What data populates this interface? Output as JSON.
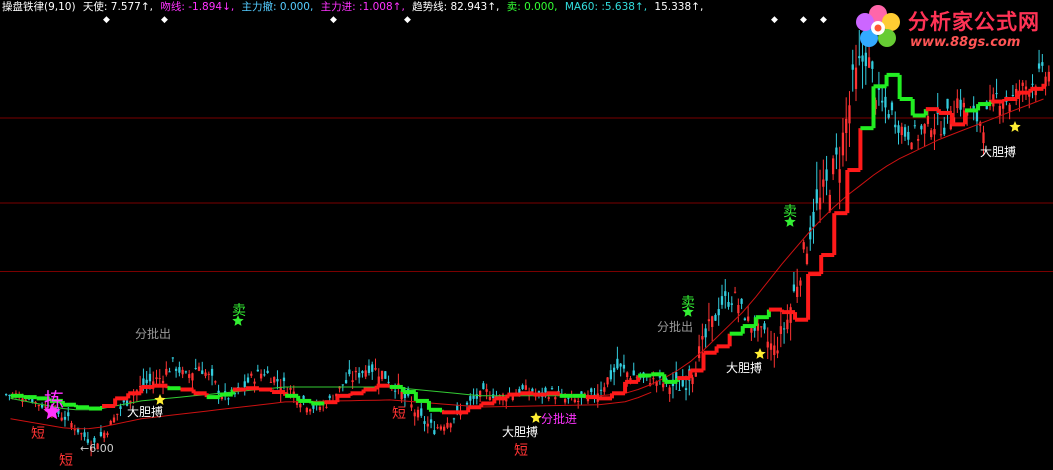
{
  "header": {
    "title": "操盘铁律(9,10)",
    "items": [
      {
        "label": "天使: 7.577↑,",
        "color": "#ffffff"
      },
      {
        "label": "吻线: -1.894↓,",
        "color": "#ff33ff"
      },
      {
        "label": "主力撤: 0.000,",
        "color": "#55ccff"
      },
      {
        "label": "主力进: :1.008↑,",
        "color": "#ff33ff"
      },
      {
        "label": "趋势线: 82.943↑,",
        "color": "#ffffff"
      },
      {
        "label": "卖: 0.000,",
        "color": "#33ff33"
      },
      {
        "label": "MA60: :5.638↑,",
        "color": "#33dddd"
      },
      {
        "label": "15.338↑,",
        "color": "#ffffff"
      }
    ]
  },
  "logo": {
    "text": "分析家公式网",
    "url": "www.88gs.com"
  },
  "colors": {
    "up_candle": "#ff3333",
    "down_candle": "#33ccdd",
    "signal_up": "#ff1a1a",
    "signal_down": "#22ee22",
    "ma_green": "#33cc33",
    "ma_red": "#cc1111",
    "hline": "#7a0000"
  },
  "annotations": [
    {
      "id": "jian",
      "text": "拣",
      "color": "#ff33ff"
    },
    {
      "id": "duan1",
      "text": "短",
      "color": "#ff3333"
    },
    {
      "id": "duan2",
      "text": "短",
      "color": "#ff3333"
    },
    {
      "id": "duan3",
      "text": "短",
      "color": "#ff3333"
    },
    {
      "id": "duan4",
      "text": "短",
      "color": "#ff3333"
    },
    {
      "id": "low",
      "text": "←6.00",
      "color": "#cccccc"
    },
    {
      "id": "fpc1",
      "text": "分批出",
      "color": "#999999"
    },
    {
      "id": "fpc2",
      "text": "分批出",
      "color": "#999999"
    },
    {
      "id": "mai1",
      "text": "卖",
      "color": "#33ee33"
    },
    {
      "id": "mai2",
      "text": "卖",
      "color": "#33ee33"
    },
    {
      "id": "mai3",
      "text": "卖",
      "color": "#33ee33"
    },
    {
      "id": "dd1",
      "text": "大胆搏",
      "color": "#ffffff"
    },
    {
      "id": "dd2",
      "text": "大胆搏",
      "color": "#ffffff"
    },
    {
      "id": "dd3",
      "text": "大胆搏",
      "color": "#ffffff"
    },
    {
      "id": "dd4",
      "text": "大胆搏",
      "color": "#ffffff"
    },
    {
      "id": "fpj",
      "text": "分批进",
      "color": "#ff33ff"
    }
  ],
  "chart_data": {
    "type": "candlestick",
    "series": [
      {
        "name": "趋势线",
        "values": [
          10.4,
          10.3,
          10.2,
          10.0,
          9.7,
          9.5,
          9.4,
          9.6,
          10.2,
          10.6,
          11.1,
          11.2,
          11.0,
          10.9,
          10.6,
          10.3,
          10.5,
          10.9,
          11.0,
          10.9,
          10.7,
          10.4,
          10.0,
          9.8,
          9.9,
          10.4,
          10.6,
          10.9,
          11.2,
          11.1,
          10.7,
          10.0,
          9.3,
          9.1,
          9.1,
          9.5,
          9.8,
          10.2,
          10.5,
          10.6,
          10.5,
          10.6,
          10.4,
          10.4,
          10.3,
          10.2,
          10.6,
          11.5,
          12.0,
          12.1,
          11.5,
          11.8,
          12.4,
          13.8,
          14.3,
          15.3,
          15.9,
          16.6,
          17.2,
          17.0,
          16.4,
          20.0,
          21.5,
          24.8,
          28.2,
          31.5,
          34.8,
          35.7,
          33.8,
          32.5,
          33.0,
          32.7,
          31.8,
          32.9,
          33.4,
          33.6,
          33.8,
          34.3,
          34.6,
          35.0
        ]
      },
      {
        "name": "MA60",
        "values": [
          10.2,
          10.0,
          9.8,
          9.6,
          9.4,
          9.3,
          9.3,
          9.4,
          9.6,
          9.8,
          10.0,
          10.1,
          10.2,
          10.3,
          10.4,
          10.5,
          10.6,
          10.7,
          10.8,
          10.9,
          11.0,
          11.1,
          11.1,
          11.1,
          11.1,
          11.1,
          11.1,
          11.1,
          11.1,
          11.1,
          11.0,
          10.9,
          10.8,
          10.7,
          10.6,
          10.5,
          10.4,
          10.4,
          10.4,
          10.4,
          10.4,
          10.4,
          10.4,
          10.4,
          10.4,
          10.4,
          10.5,
          10.6,
          10.9,
          11.3,
          11.8,
          12.4,
          13.1,
          14.0,
          15.0,
          16.0,
          17.0,
          18.2,
          19.5,
          20.8,
          22.0,
          23.2,
          24.3,
          25.3,
          26.2,
          27.0,
          27.8,
          28.5,
          29.1,
          29.6,
          30.1,
          30.6,
          31.0,
          31.4,
          31.8,
          32.2,
          32.6,
          33.0,
          33.4,
          33.8
        ]
      },
      {
        "name": "close",
        "values": [
          10.5,
          10.2,
          9.6,
          9.2,
          8.5,
          7.4,
          6.6,
          7.8,
          9.4,
          10.6,
          11.4,
          11.8,
          12.9,
          11.9,
          12.8,
          11.6,
          10.2,
          10.6,
          11.8,
          12.3,
          11.6,
          10.9,
          9.9,
          9.4,
          10.0,
          11.3,
          12.0,
          12.7,
          12.2,
          11.2,
          9.9,
          8.5,
          7.8,
          8.4,
          9.1,
          10.1,
          10.7,
          10.3,
          10.6,
          10.9,
          10.4,
          10.7,
          10.1,
          10.0,
          10.3,
          11.4,
          12.6,
          12.1,
          11.7,
          11.6,
          11.2,
          11.2,
          13.0,
          15.6,
          17.8,
          18.1,
          16.3,
          15.3,
          14.0,
          16.4,
          20.5,
          24.4,
          26.8,
          29.3,
          34.7,
          37.6,
          33.5,
          32.6,
          31.1,
          31.0,
          32.0,
          31.7,
          33.7,
          32.6,
          31.9,
          34.0,
          33.6,
          34.6,
          35.4,
          35.8
        ]
      },
      {
        "name": "range",
        "values": [
          1.2,
          1.0,
          1.0,
          1.2,
          1.4,
          1.3,
          1.6,
          1.6,
          1.5,
          1.8,
          2.2,
          2.0,
          2.2,
          1.8,
          2.0,
          2.0,
          2.0,
          1.6,
          1.8,
          1.8,
          1.8,
          1.8,
          1.8,
          1.6,
          1.6,
          1.6,
          2.0,
          2.0,
          2.2,
          2.0,
          2.2,
          2.0,
          1.8,
          1.6,
          1.6,
          1.6,
          1.6,
          1.4,
          1.6,
          1.4,
          1.4,
          1.4,
          1.4,
          1.4,
          1.8,
          2.4,
          2.6,
          2.2,
          1.6,
          1.4,
          1.8,
          2.6,
          3.2,
          3.4,
          3.0,
          2.6,
          2.2,
          2.4,
          3.2,
          3.4,
          4.2,
          4.4,
          5.6,
          5.6,
          6.0,
          5.8,
          4.2,
          3.2,
          3.0,
          2.8,
          3.0,
          3.2,
          3.6,
          3.0,
          3.0,
          3.2,
          3.0,
          3.2,
          3.4,
          3.4
        ]
      },
      {
        "name": "signal",
        "values": [
          0,
          0,
          0,
          0,
          0,
          0,
          0,
          1,
          1,
          1,
          1,
          1,
          0,
          1,
          1,
          0,
          0,
          1,
          1,
          1,
          1,
          0,
          0,
          0,
          1,
          1,
          1,
          1,
          1,
          0,
          0,
          0,
          0,
          1,
          1,
          1,
          1,
          1,
          1,
          1,
          1,
          1,
          0,
          0,
          1,
          1,
          1,
          1,
          0,
          0,
          0,
          1,
          1,
          1,
          1,
          0,
          0,
          0,
          1,
          1,
          1,
          1,
          1,
          1,
          1,
          0,
          0,
          0,
          0,
          0,
          1,
          1,
          1,
          0,
          0,
          1,
          1,
          1,
          1,
          1
        ]
      }
    ],
    "lows_label": "←6.00",
    "hlines": [
      20.2,
      25.6,
      32.3
    ],
    "ylim": [
      5.5,
      40.5
    ],
    "grid": false
  }
}
